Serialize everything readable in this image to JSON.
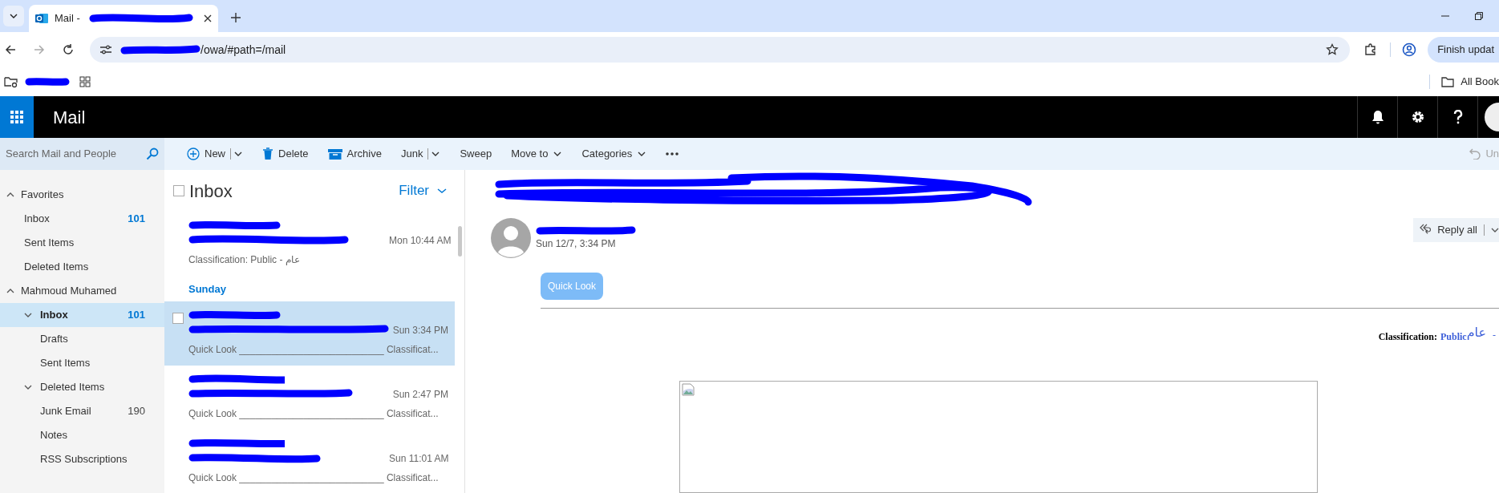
{
  "browser": {
    "tab_title": "Mail - ",
    "url": "/owa/#path=/mail",
    "update_button": "Finish updat",
    "all_bookmarks": "All Book"
  },
  "app": {
    "title": "Mail"
  },
  "search": {
    "placeholder": "Search Mail and People"
  },
  "toolbar": [
    {
      "kind": "new",
      "label": "New",
      "disabled": false
    },
    {
      "kind": "delete",
      "label": "Delete",
      "disabled": false
    },
    {
      "kind": "archive",
      "label": "Archive",
      "disabled": false
    },
    {
      "kind": "split",
      "label": "Junk",
      "disabled": false
    },
    {
      "kind": "plain",
      "label": "Sweep",
      "disabled": false
    },
    {
      "kind": "menu",
      "label": "Move to",
      "disabled": false
    },
    {
      "kind": "menu",
      "label": "Categories",
      "disabled": false
    },
    {
      "kind": "more",
      "disabled": false
    },
    {
      "kind": "undo",
      "label": "Un",
      "disabled": true
    }
  ],
  "nav": [
    {
      "label": "Favorites",
      "expanded": true,
      "children": [
        {
          "label": "Inbox",
          "count": "101",
          "unread": true,
          "selected": false
        },
        {
          "label": "Sent Items",
          "selected": false
        },
        {
          "label": "Deleted Items",
          "selected": false
        }
      ]
    },
    {
      "label": "Mahmoud Muhamed",
      "expanded": true,
      "children": [
        {
          "label": "Inbox",
          "count": "101",
          "unread": true,
          "selected": true,
          "expanded": true
        },
        {
          "label": "Drafts",
          "selected": false
        },
        {
          "label": "Sent Items",
          "selected": false
        },
        {
          "label": "Deleted Items",
          "selected": false,
          "expanded": true
        },
        {
          "label": "Junk Email",
          "count": "190",
          "unread": false,
          "selected": false
        },
        {
          "label": "Notes",
          "selected": false
        },
        {
          "label": "RSS Subscriptions",
          "selected": false
        }
      ]
    }
  ],
  "list": {
    "title": "Inbox",
    "select_all": {
      "checked": false
    },
    "filter": "Filter",
    "items": [
      {
        "kind": "message",
        "time": "Mon 10:44 AM",
        "preview": "Classification: Public - عام",
        "selected": false
      },
      {
        "kind": "group",
        "label": "Sunday"
      },
      {
        "kind": "message",
        "time": "Sun 3:34 PM",
        "preview": "Quick Look ___________________________ Classificat...",
        "selected": true
      },
      {
        "kind": "message",
        "time": "Sun 2:47 PM",
        "preview": "Quick Look ___________________________ Classificat...",
        "selected": false
      },
      {
        "kind": "message",
        "time": "Sun 11:01 AM",
        "preview": "Quick Look ___________________________ Classificat...",
        "selected": false
      }
    ]
  },
  "reading": {
    "date": "Sun 12/7, 3:34 PM",
    "reply": "Reply all",
    "quick_look": "Quick Look",
    "classification": {
      "label": "Classification:",
      "value": "Public",
      "arabic": "عام",
      "dash": "-"
    }
  }
}
